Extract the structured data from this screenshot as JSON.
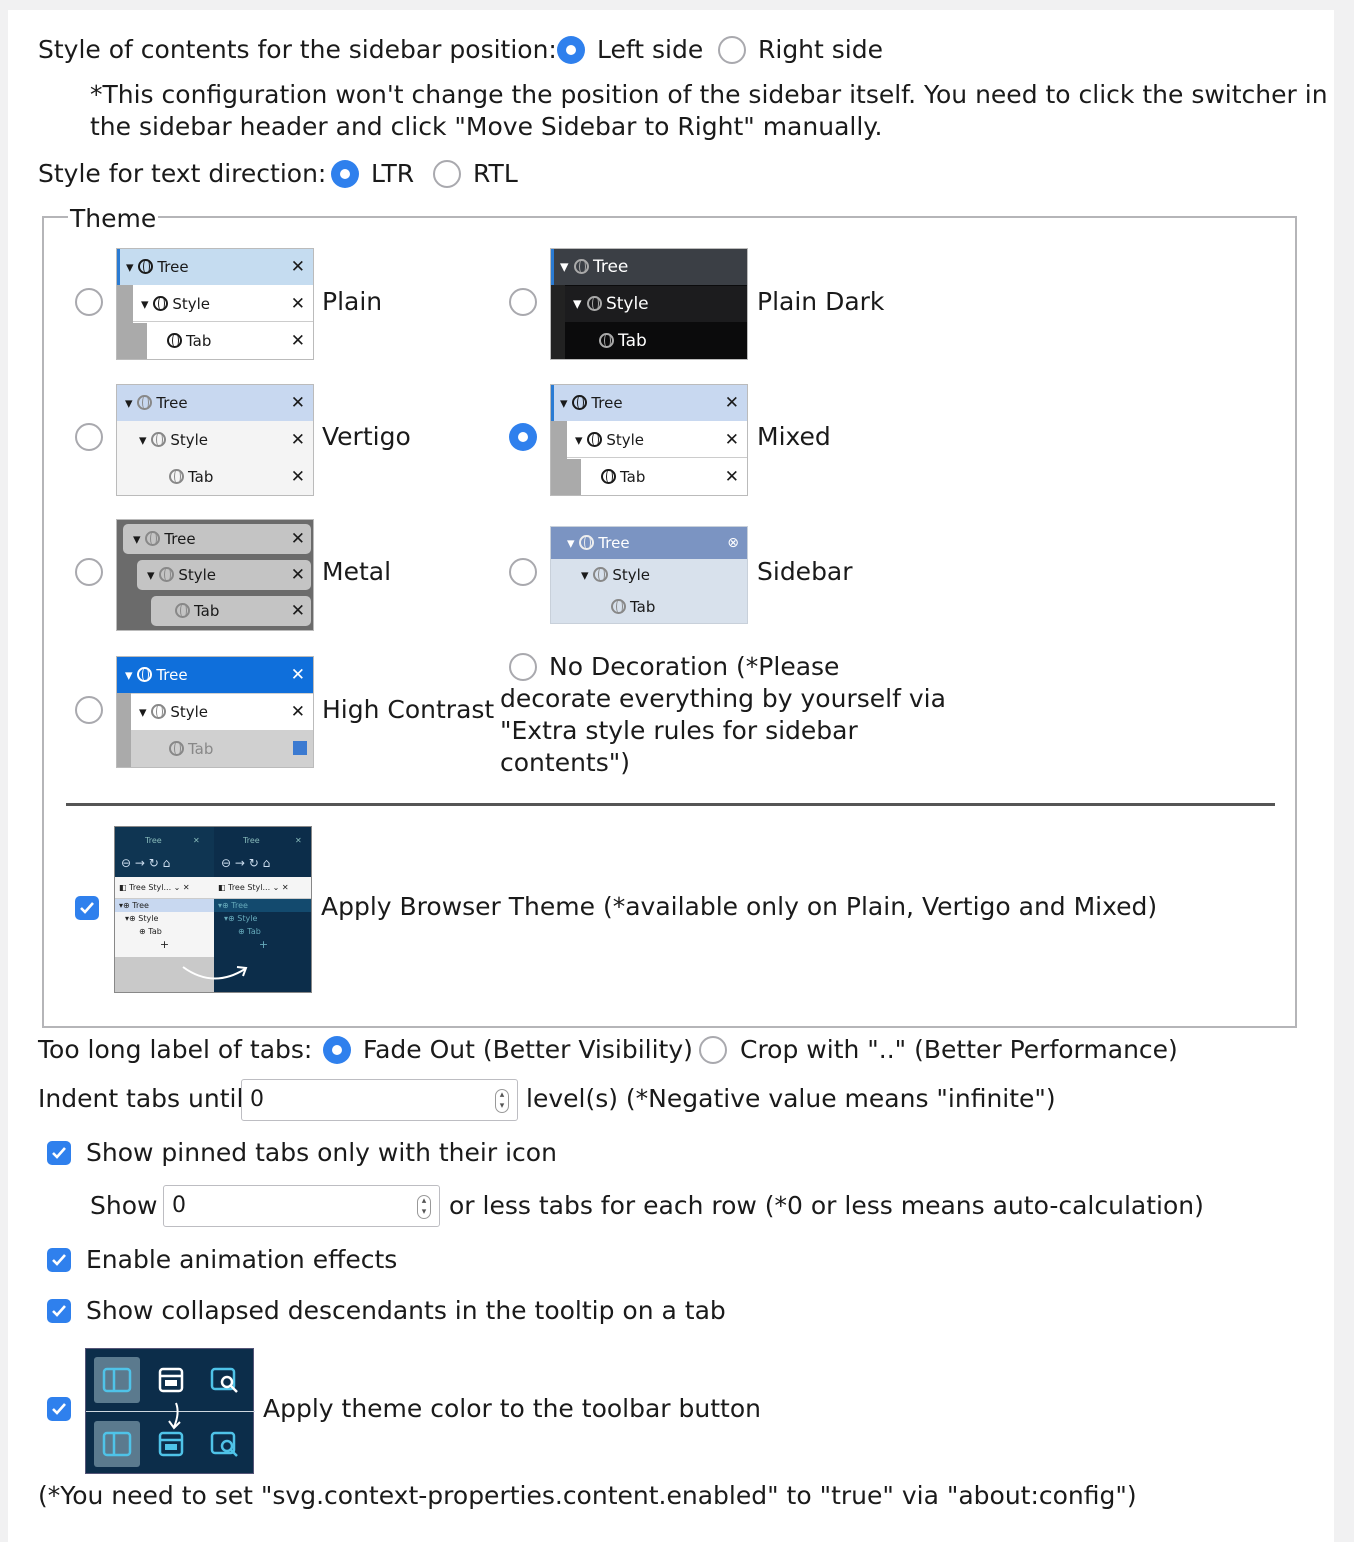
{
  "sidebar_position": {
    "label": "Style of contents for the sidebar position:",
    "options": [
      "Left side",
      "Right side"
    ],
    "selected": "Left side",
    "note_line1": "*This configuration won't change the position of the sidebar itself. You need to click the switcher in",
    "note_line2": "the sidebar header and click \"Move Sidebar to Right\" manually."
  },
  "text_direction": {
    "label": "Style for text direction:",
    "options": [
      "LTR",
      "RTL"
    ],
    "selected": "LTR"
  },
  "theme": {
    "legend": "Theme",
    "selected": "Mixed",
    "options": [
      "Plain",
      "Plain Dark",
      "Vertigo",
      "Mixed",
      "Metal",
      "Sidebar",
      "High Contrast"
    ],
    "no_decoration_line1": "No Decoration (*Please",
    "no_decoration_line2": "decorate everything by yourself via",
    "no_decoration_line3": "\"Extra style rules for sidebar",
    "no_decoration_line4": "contents\")",
    "preview_labels": {
      "tree": "Tree",
      "style": "Style",
      "tab": "Tab",
      "tree_short": "Tree Styl..."
    },
    "apply_browser_theme": {
      "label": "Apply Browser Theme (*available only on Plain, Vertigo and Mixed)",
      "checked": true
    }
  },
  "long_label": {
    "label": "Too long label of tabs:",
    "options": [
      "Fade Out (Better Visibility)",
      "Crop with \"..\" (Better Performance)"
    ],
    "selected": "Fade Out (Better Visibility)"
  },
  "indent": {
    "label_before": "Indent tabs until",
    "value": "0",
    "label_after": "level(s) (*Negative value means \"infinite\")"
  },
  "pinned": {
    "label": "Show pinned tabs only with their icon",
    "checked": true,
    "show_label": "Show",
    "value": "0",
    "after_label": "or less tabs for each row (*0 or less means auto-calculation)"
  },
  "animation": {
    "label": "Enable animation effects",
    "checked": true
  },
  "tooltip": {
    "label": "Show collapsed descendants in the tooltip on a tab",
    "checked": true
  },
  "toolbar_theme": {
    "label": "Apply theme color to the toolbar button",
    "checked": true
  },
  "footnote": "(*You need to set \"svg.context-properties.content.enabled\" to \"true\" via \"about:config\")",
  "colors": {
    "accent": "#2f80ed",
    "dark_navy": "#0c2d4a"
  }
}
